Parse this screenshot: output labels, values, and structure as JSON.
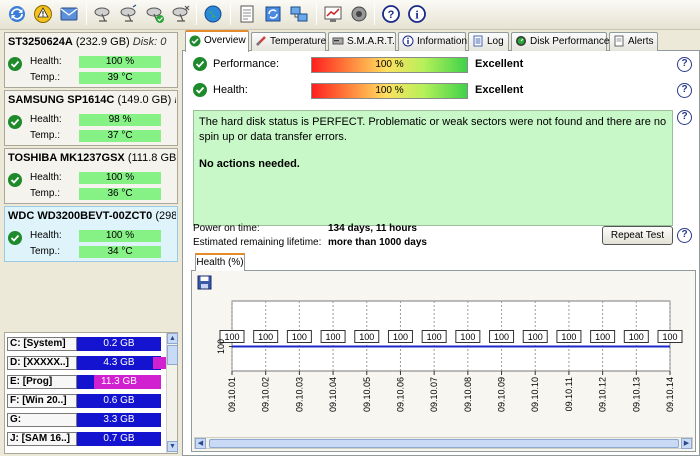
{
  "toolbar": {
    "buttons": [
      "refresh-icon",
      "warning-icon",
      "mail-icon",
      "sat-dish-1-icon",
      "sat-dish-2-icon",
      "sat-dish-check-icon",
      "sat-dish-x-icon",
      "globe-icon",
      "document-icon",
      "sync-icon",
      "network-icon",
      "chart-icon",
      "sound-icon",
      "help-icon",
      "info-icon"
    ]
  },
  "disks": [
    {
      "name": "ST3250624A",
      "size": "(232.9 GB)",
      "extra": "Disk: 0",
      "health_label": "Health:",
      "health": "100 %",
      "temp_label": "Temp.:",
      "temp": "39 °C"
    },
    {
      "name": "SAMSUNG SP1614C",
      "size": "(149.0 GB)",
      "extra": "D",
      "health_label": "Health:",
      "health": "98 %",
      "temp_label": "Temp.:",
      "temp": "37 °C"
    },
    {
      "name": "TOSHIBA MK1237GSX",
      "size": "(111.8 GB)",
      "extra": "",
      "health_label": "Health:",
      "health": "100 %",
      "temp_label": "Temp.:",
      "temp": "36 °C"
    },
    {
      "name": "WDC WD3200BEVT-00ZCT0",
      "size": "(298",
      "extra": "",
      "health_label": "Health:",
      "health": "100 %",
      "temp_label": "Temp.:",
      "temp": "34 °C"
    }
  ],
  "drives": [
    {
      "label": "C: [System]",
      "free": "0.2 GB",
      "fill": 1.0
    },
    {
      "label": "D: [XXXXX..]",
      "free": "4.3 GB",
      "fill": 0.82
    },
    {
      "label": "E: [Prog]",
      "free": "11.3 GB",
      "fill": 0.6
    },
    {
      "label": "F: [Win 20..]",
      "free": "0.6 GB",
      "fill": 1.0
    },
    {
      "label": "G:",
      "free": "3.3 GB",
      "fill": 1.0
    },
    {
      "label": "J: [SAM 16..]",
      "free": "0.7 GB",
      "fill": 1.0
    }
  ],
  "tabs": [
    "Overview",
    "Temperature",
    "S.M.A.R.T.",
    "Information",
    "Log",
    "Disk Performance",
    "Alerts"
  ],
  "overview": {
    "performance_label": "Performance:",
    "performance_value": "100 %",
    "performance_rating": "Excellent",
    "health_label": "Health:",
    "health_value": "100 %",
    "health_rating": "Excellent",
    "status_text": "The hard disk status is PERFECT. Problematic or weak sectors were not found and there are no spin up or data transfer errors.",
    "action_text": "No actions needed.",
    "power_on_label": "Power on time:",
    "power_on_value": "134 days, 11 hours",
    "lifetime_label": "Estimated remaining lifetime:",
    "lifetime_value": "more than 1000 days",
    "repeat_button": "Repeat Test",
    "help_glyph": "?"
  },
  "chart_tab": "Health (%)",
  "chart_data": {
    "type": "line",
    "title": "",
    "ylabel": "100",
    "x": [
      "09.10.01",
      "09.10.02",
      "09.10.03",
      "09.10.04",
      "09.10.05",
      "09.10.06",
      "09.10.07",
      "09.10.08",
      "09.10.09",
      "09.10.10",
      "09.10.11",
      "09.10.12",
      "09.10.13",
      "09.10.14"
    ],
    "series": [
      {
        "values": [
          100,
          100,
          100,
          100,
          100,
          100,
          100,
          100,
          100,
          100,
          100,
          100,
          100,
          100
        ]
      }
    ],
    "labels": [
      "100",
      "100",
      "100",
      "100",
      "100",
      "100",
      "100",
      "100",
      "100",
      "100",
      "100",
      "100",
      "100",
      "100"
    ],
    "grid": true,
    "line_color": "#1e28c8"
  }
}
